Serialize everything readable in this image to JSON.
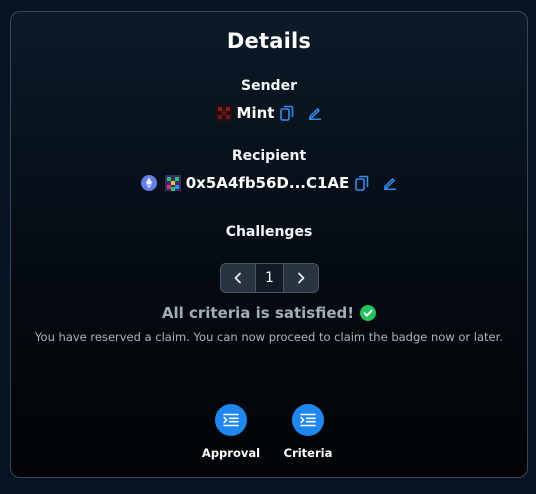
{
  "details": {
    "title": "Details",
    "sender_label": "Sender",
    "sender_name": "Mint",
    "recipient_label": "Recipient",
    "recipient_address": "0x5A4fb56D...C1AE",
    "challenges_label": "Challenges",
    "page_number": "1",
    "status_text": "All criteria is satisfied!",
    "note_text": "You have reserved a claim. You can now proceed to claim the badge now or later."
  },
  "tabs": [
    {
      "label": "Approval",
      "icon": "list-icon"
    },
    {
      "label": "Criteria",
      "icon": "list-icon"
    }
  ],
  "colors": {
    "accent": "#1f87f0",
    "success": "#22c55e",
    "background": "#071523",
    "border": "#3a4654"
  }
}
